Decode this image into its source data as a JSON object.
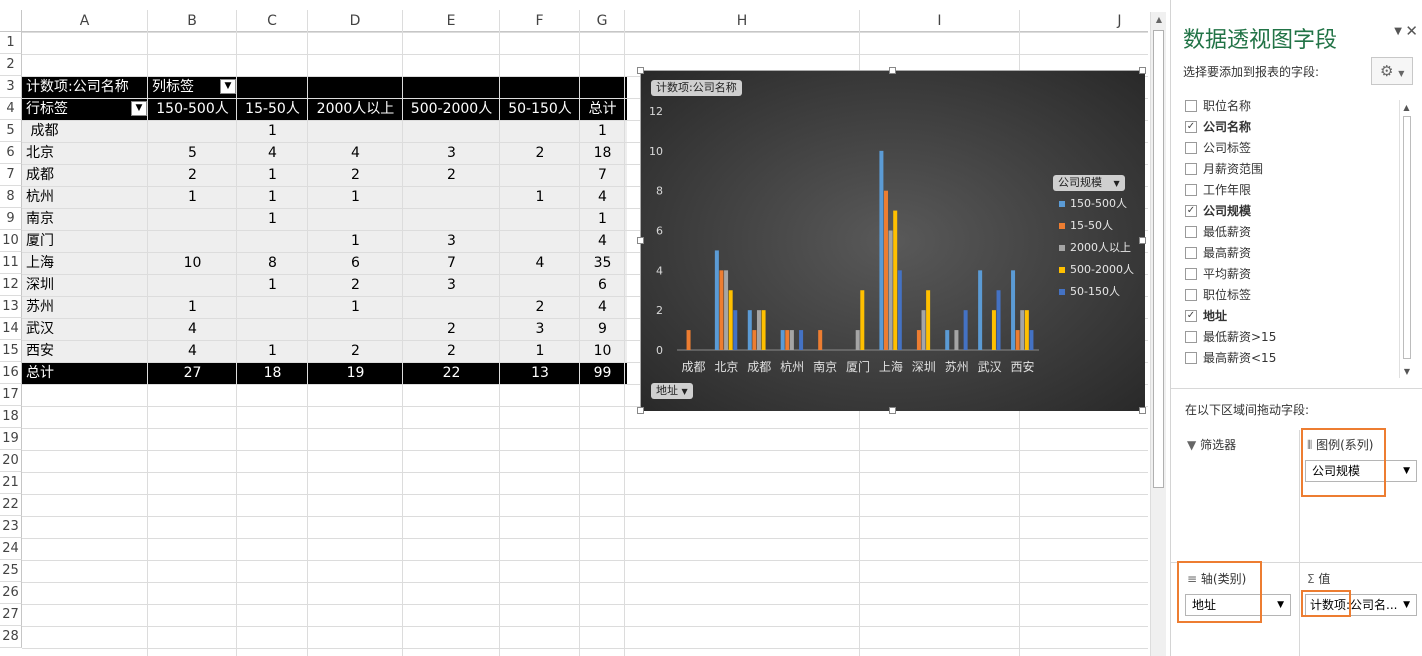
{
  "columns": [
    "A",
    "B",
    "C",
    "D",
    "E",
    "F",
    "G",
    "H",
    "I",
    "J"
  ],
  "rows": [
    "1",
    "2",
    "3",
    "4",
    "5",
    "6",
    "7",
    "8",
    "9",
    "10",
    "11",
    "12",
    "13",
    "14",
    "15",
    "16",
    "17",
    "18",
    "19",
    "20",
    "21",
    "22",
    "23",
    "24",
    "25",
    "26",
    "27",
    "28"
  ],
  "pivot": {
    "value_label": "计数项:公司名称",
    "col_label": "列标签",
    "row_label": "行标签",
    "headers": [
      "150-500人",
      "15-50人",
      "2000人以上",
      "500-2000人",
      "50-150人",
      "总计"
    ],
    "rows": [
      {
        "label": " 成都",
        "values": [
          "",
          "1",
          "",
          "",
          "",
          "1"
        ]
      },
      {
        "label": "北京",
        "values": [
          "5",
          "4",
          "4",
          "3",
          "2",
          "18"
        ]
      },
      {
        "label": "成都",
        "values": [
          "2",
          "1",
          "2",
          "2",
          "",
          "7"
        ]
      },
      {
        "label": "杭州",
        "values": [
          "1",
          "1",
          "1",
          "",
          "1",
          "4"
        ]
      },
      {
        "label": "南京",
        "values": [
          "",
          "1",
          "",
          "",
          "",
          "1"
        ]
      },
      {
        "label": "厦门",
        "values": [
          "",
          "",
          "1",
          "3",
          "",
          "4"
        ]
      },
      {
        "label": "上海",
        "values": [
          "10",
          "8",
          "6",
          "7",
          "4",
          "35"
        ]
      },
      {
        "label": "深圳",
        "values": [
          "",
          "1",
          "2",
          "3",
          "",
          "6"
        ]
      },
      {
        "label": "苏州",
        "values": [
          "1",
          "",
          "1",
          "",
          "2",
          "4"
        ]
      },
      {
        "label": "武汉",
        "values": [
          "4",
          "",
          "",
          "2",
          "3",
          "9"
        ]
      },
      {
        "label": "西安",
        "values": [
          "4",
          "1",
          "2",
          "2",
          "1",
          "10"
        ]
      }
    ],
    "total": {
      "label": "总计",
      "values": [
        "27",
        "18",
        "19",
        "22",
        "13",
        "99"
      ]
    }
  },
  "chart_data": {
    "type": "bar",
    "title": "",
    "value_button": "计数项:公司名称",
    "axis_button": "地址",
    "legend_button": "公司规模",
    "categories": [
      "成都",
      "北京",
      "成都",
      "杭州",
      "南京",
      "厦门",
      "上海",
      "深圳",
      "苏州",
      "武汉",
      "西安"
    ],
    "ylim": [
      0,
      12
    ],
    "yticks": [
      "0",
      "2",
      "4",
      "6",
      "8",
      "10",
      "12"
    ],
    "grid": false,
    "legend_position": "right",
    "series": [
      {
        "name": "150-500人",
        "color": "#5b9bd5",
        "values": [
          0,
          5,
          2,
          1,
          0,
          0,
          10,
          0,
          1,
          4,
          4
        ]
      },
      {
        "name": "15-50人",
        "color": "#ed7d31",
        "values": [
          1,
          4,
          1,
          1,
          1,
          0,
          8,
          1,
          0,
          0,
          1
        ]
      },
      {
        "name": "2000人以上",
        "color": "#a5a5a5",
        "values": [
          0,
          4,
          2,
          1,
          0,
          1,
          6,
          2,
          1,
          0,
          2
        ]
      },
      {
        "name": "500-2000人",
        "color": "#ffc000",
        "values": [
          0,
          3,
          2,
          0,
          0,
          3,
          7,
          3,
          0,
          2,
          2
        ]
      },
      {
        "name": "50-150人",
        "color": "#4472c4",
        "values": [
          0,
          2,
          0,
          1,
          0,
          0,
          4,
          0,
          2,
          3,
          1
        ]
      }
    ]
  },
  "panel": {
    "title": "数据透视图字段",
    "subtitle": "选择要添加到报表的字段:",
    "fields": [
      {
        "label": "职位名称",
        "checked": false
      },
      {
        "label": "公司名称",
        "checked": true
      },
      {
        "label": "公司标签",
        "checked": false
      },
      {
        "label": "月薪资范围",
        "checked": false
      },
      {
        "label": "工作年限",
        "checked": false
      },
      {
        "label": "公司规模",
        "checked": true
      },
      {
        "label": "最低薪资",
        "checked": false
      },
      {
        "label": "最高薪资",
        "checked": false
      },
      {
        "label": "平均薪资",
        "checked": false
      },
      {
        "label": "职位标签",
        "checked": false
      },
      {
        "label": "地址",
        "checked": true
      },
      {
        "label": "最低薪资>15",
        "checked": false
      },
      {
        "label": "最高薪资<15",
        "checked": false
      }
    ],
    "drag_hint": "在以下区域间拖动字段:",
    "filter_title": "筛选器",
    "legend_title": "图例(系列)",
    "legend_value": "公司规模",
    "axis_title": "轴(类别)",
    "axis_value": "地址",
    "values_title": "值",
    "values_value": "计数项:公司名..."
  },
  "colors": {
    "accent": "#217346",
    "highlight": "#ed7d31",
    "chart_bg": "#3a3a3a"
  }
}
